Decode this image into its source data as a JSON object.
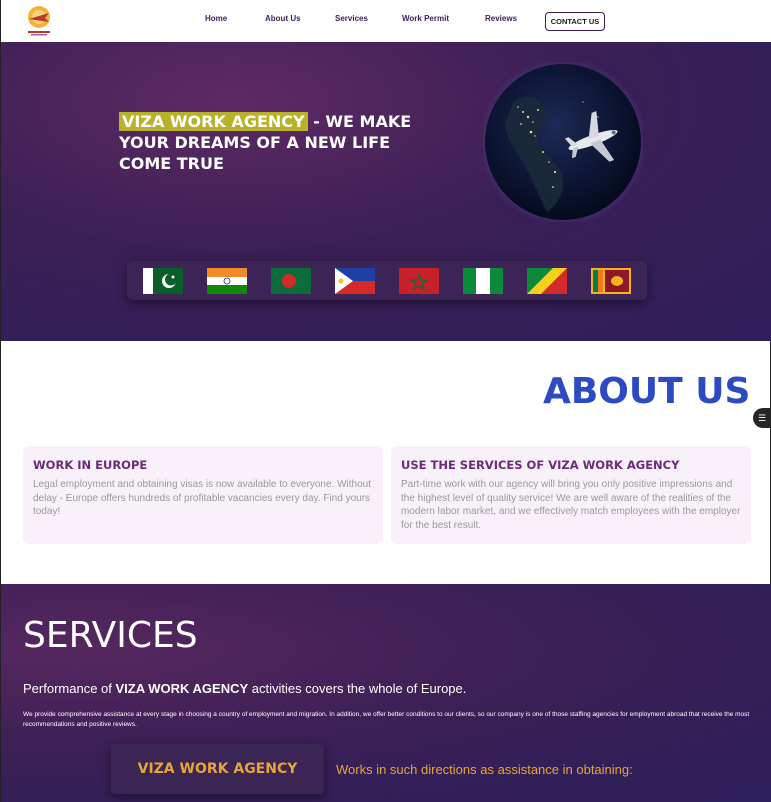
{
  "nav": {
    "items": [
      "Home",
      "About Us",
      "Services",
      "Work Permit",
      "Reviews"
    ],
    "contact": "CONTACT US"
  },
  "hero": {
    "highlight": "VIZA WORK AGENCY",
    "title_rest": " - WE MAKE YOUR DREAMS OF A NEW LIFE COME TRUE"
  },
  "flags": [
    "pakistan-flag",
    "india-flag",
    "bangladesh-flag",
    "philippines-flag",
    "morocco-flag",
    "nigeria-flag",
    "congo-flag",
    "sri-lanka-flag"
  ],
  "about": {
    "title": "ABOUT US",
    "cards": [
      {
        "title": "WORK IN EUROPE",
        "text": "Legal employment and obtaining visas is now available to everyone. Without delay - Europe offers hundreds of profitable vacancies every day. Find yours today!"
      },
      {
        "title": "USE THE SERVICES OF VIZA WORK AGENCY",
        "text": "Part-time work with our agency will bring you only positive impressions and the highest level of quality service! We are well aware of the realities of the modern labor market, and we effectively match employees with the employer for the best result."
      }
    ]
  },
  "services": {
    "title": "SERVICES",
    "sub_pre": "Performance of ",
    "sub_bold": "VIZA WORK AGENCY",
    "sub_post": " activities covers the whole of Europe.",
    "small": "We provide comprehensive assistance at every stage in choosing a country of employment and migration. In addition, we offer better conditions to our clients, so our company is one of those staffing agencies for employment abroad that receive the most recommendations and positive reviews.",
    "button": "VIZA WORK AGENCY",
    "right_text": "Works in such directions as assistance in obtaining:"
  },
  "colors": {
    "accent_blue": "#2c4bc3",
    "highlight": "#b7b22a",
    "orange": "#e6a53a",
    "purple": "#3a1f55"
  }
}
